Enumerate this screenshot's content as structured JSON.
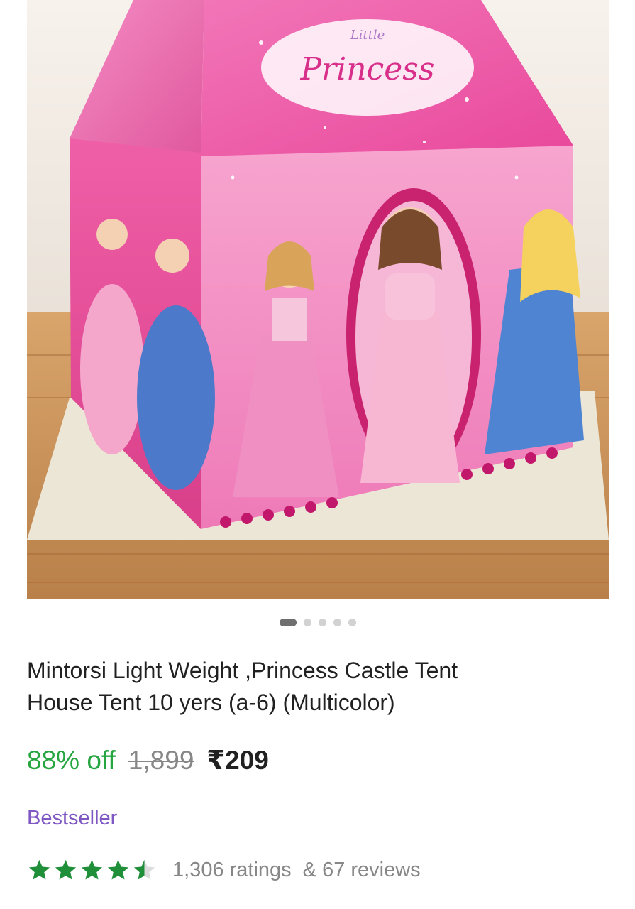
{
  "product": {
    "image_text": "Little Princess",
    "title_line1": "Mintorsi Light Weight ,Princess Castle Tent",
    "title_line2": "House Tent 10 yers (a-6) (Multicolor)",
    "discount": "88% off",
    "mrp": "1,899",
    "price": "₹209",
    "badge": "Bestseller",
    "rating_value": 4.5,
    "ratings_text": "1,306 ratings",
    "reviews_text": "& 67 reviews"
  },
  "carousel": {
    "total": 5,
    "active": 1
  },
  "colors": {
    "discount": "#26a541",
    "badge": "#7e57c2",
    "stars": "#1f8f3a",
    "tent_pink": "#e8489a"
  },
  "icons": [
    "star-full-icon",
    "star-half-icon"
  ]
}
